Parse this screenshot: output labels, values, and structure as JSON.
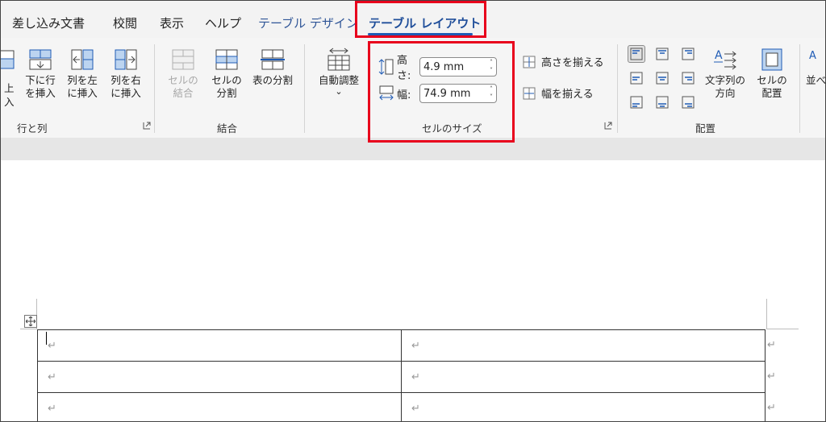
{
  "tabs": [
    {
      "label": "差し込み文書",
      "state": "normal"
    },
    {
      "label": "校閲",
      "state": "normal"
    },
    {
      "label": "表示",
      "state": "normal"
    },
    {
      "label": "ヘルプ",
      "state": "normal"
    },
    {
      "label": "テーブル デザイン",
      "state": "design"
    },
    {
      "label": "テーブル レイアウト",
      "state": "active"
    }
  ],
  "rows_cols": {
    "group_label": "行と列",
    "partial_above_top": "上",
    "partial_above_bottom": "入",
    "insert_below": "下に行\nを挿入",
    "insert_left": "列を左\nに挿入",
    "insert_right": "列を右\nに挿入"
  },
  "merge": {
    "group_label": "結合",
    "merge_cells": "セルの\n結合",
    "split_cells": "セルの\n分割",
    "split_table": "表の分割"
  },
  "autofit": {
    "label": "自動調整",
    "chevron": "⌄"
  },
  "cell_size": {
    "group_label": "セルのサイズ",
    "height_label": "高さ:",
    "height_value": "4.9 mm",
    "width_label": "幅:",
    "width_value": "74.9 mm",
    "distribute_rows": "高さを揃える",
    "distribute_cols": "幅を揃える"
  },
  "alignment": {
    "group_label": "配置",
    "text_direction": "文字列の\n方向",
    "cell_margins": "セルの\n配置",
    "partial_sort": "並べ"
  },
  "spinner_arrows": {
    "up": "˄",
    "down": "˅"
  },
  "doc": {
    "paragraph_mark": "↵",
    "rows": [
      [
        "↵",
        "↵"
      ],
      [
        "↵",
        "↵"
      ],
      [
        "↵",
        "↵"
      ]
    ],
    "row_end_marks": [
      "↵",
      "↵",
      "↵"
    ]
  },
  "colors": {
    "highlight": "#e8001c",
    "accent": "#1f5bb5"
  }
}
